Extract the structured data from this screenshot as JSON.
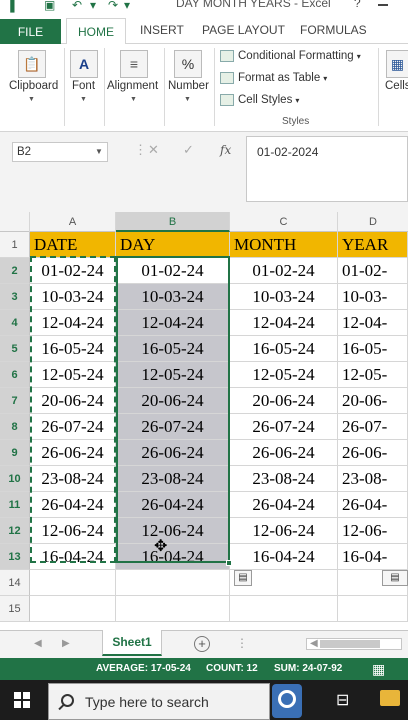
{
  "window": {
    "title": "DAY MONTH YEARS - Excel",
    "help": "?"
  },
  "ribbon": {
    "tabs": [
      "FILE",
      "HOME",
      "INSERT",
      "PAGE LAYOUT",
      "FORMULAS"
    ],
    "groups": {
      "clipboard": "Clipboard",
      "font": "Font",
      "alignment": "Alignment",
      "number": "Number",
      "cells": "Cells"
    },
    "styles": {
      "conditional_formatting": "Conditional Formatting",
      "format_as_table": "Format as Table",
      "cell_styles": "Cell Styles",
      "caption": "Styles"
    }
  },
  "formula_bar": {
    "name_box": "B2",
    "fx": "fx",
    "value": "01-02-2024"
  },
  "grid": {
    "columns": [
      "A",
      "B",
      "C",
      "D"
    ],
    "rows": [
      "1",
      "2",
      "3",
      "4",
      "5",
      "6",
      "7",
      "8",
      "9",
      "10",
      "11",
      "12",
      "13",
      "14",
      "15"
    ],
    "headers": [
      "DATE",
      "DAY",
      "MONTH",
      "YEAR"
    ],
    "data": [
      [
        "01-02-24",
        "01-02-24",
        "01-02-24",
        "01-02-"
      ],
      [
        "10-03-24",
        "10-03-24",
        "10-03-24",
        "10-03-"
      ],
      [
        "12-04-24",
        "12-04-24",
        "12-04-24",
        "12-04-"
      ],
      [
        "16-05-24",
        "16-05-24",
        "16-05-24",
        "16-05-"
      ],
      [
        "12-05-24",
        "12-05-24",
        "12-05-24",
        "12-05-"
      ],
      [
        "20-06-24",
        "20-06-24",
        "20-06-24",
        "20-06-"
      ],
      [
        "26-07-24",
        "26-07-24",
        "26-07-24",
        "26-07-"
      ],
      [
        "26-06-24",
        "26-06-24",
        "26-06-24",
        "26-06-"
      ],
      [
        "23-08-24",
        "23-08-24",
        "23-08-24",
        "23-08-"
      ],
      [
        "26-04-24",
        "26-04-24",
        "26-04-24",
        "26-04-"
      ],
      [
        "12-06-24",
        "12-06-24",
        "12-06-24",
        "12-06-"
      ],
      [
        "16-04-24",
        "16-04-24",
        "16-04-24",
        "16-04-"
      ]
    ],
    "header_fill": "#f1b600",
    "selection_fill": "#c6c6cc"
  },
  "sheets": {
    "active": "Sheet1",
    "add": "+"
  },
  "status": {
    "average": "AVERAGE: 17-05-24",
    "count": "COUNT: 12",
    "sum": "SUM: 24-07-92",
    "accent": "#217346"
  },
  "taskbar": {
    "search_placeholder": "Type here to search"
  }
}
